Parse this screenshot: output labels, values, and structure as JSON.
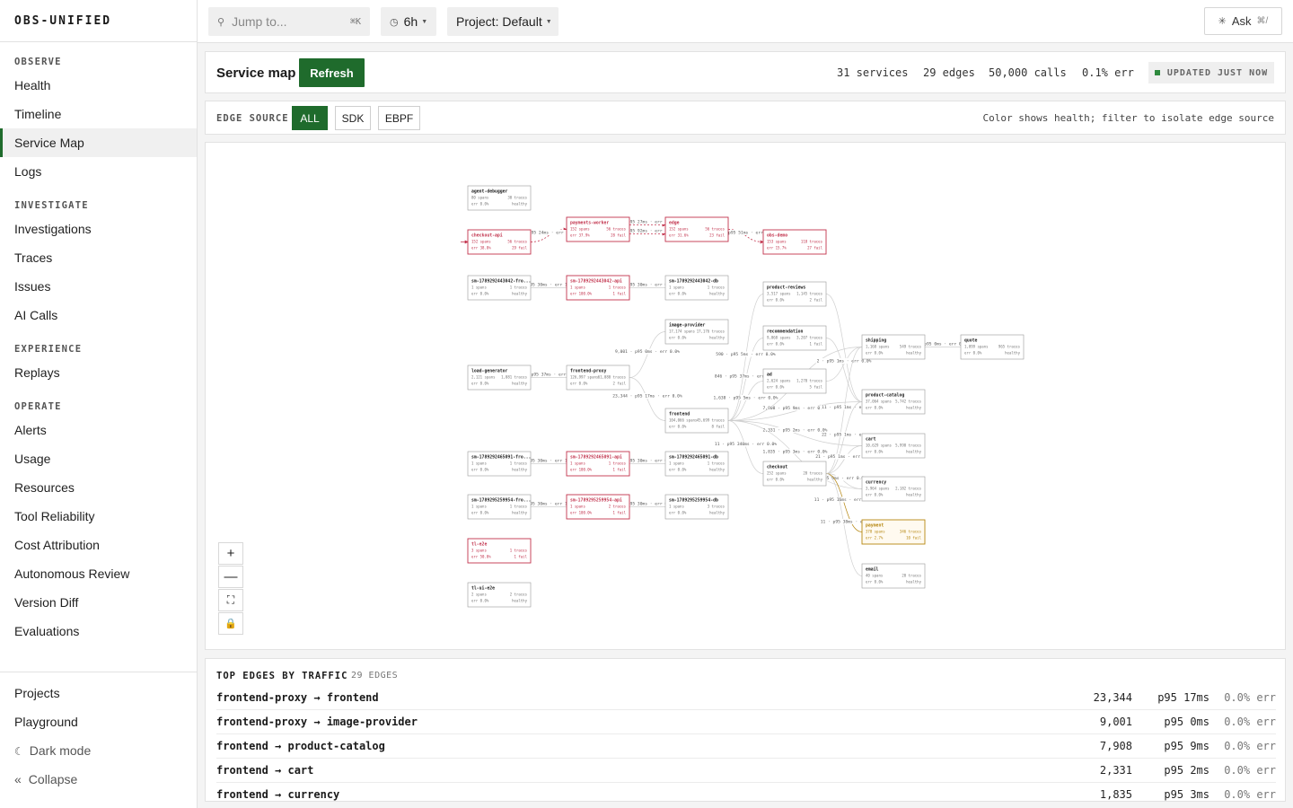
{
  "brand": "OBS-UNIFIED",
  "nav": {
    "sections": [
      {
        "title": "OBSERVE",
        "items": [
          "Health",
          "Timeline",
          "Service Map",
          "Logs"
        ]
      },
      {
        "title": "INVESTIGATE",
        "items": [
          "Investigations",
          "Traces",
          "Issues",
          "AI Calls"
        ]
      },
      {
        "title": "EXPERIENCE",
        "items": [
          "Replays"
        ]
      },
      {
        "title": "OPERATE",
        "items": [
          "Alerts",
          "Usage",
          "Resources",
          "Tool Reliability",
          "Cost Attribution",
          "Autonomous Review",
          "Version Diff",
          "Evaluations"
        ]
      }
    ],
    "active": "Service Map",
    "bottom": {
      "projects": "Projects",
      "playground": "Playground",
      "dark_mode": "Dark mode",
      "collapse": "Collapse"
    }
  },
  "topbar": {
    "jump_placeholder": "Jump to...",
    "jump_kbd": "⌘K",
    "range": "6h",
    "project": "Project: Default",
    "ask": "Ask",
    "ask_kbd": "⌘/"
  },
  "header": {
    "title": "Service map",
    "refresh": "Refresh",
    "stats": {
      "services": "31 services",
      "edges": "29 edges",
      "calls": "50,000 calls",
      "err": "0.1% err"
    },
    "updated": "UPDATED JUST NOW"
  },
  "filter": {
    "label": "EDGE SOURCE",
    "options": [
      "ALL",
      "SDK",
      "EBPF"
    ],
    "selected": "ALL",
    "hint": "Color shows health; filter to isolate edge source"
  },
  "colors": {
    "accent": "#1f6b2c",
    "error": "#c2334d",
    "warning": "#b5860f",
    "healthy": "#999999"
  },
  "map": {
    "nodes": [
      {
        "id": "agent-debugger",
        "name": "agent-debugger",
        "spans": "80 spans",
        "traces": "30 traces",
        "err": "err 0.0%",
        "status": "healthy",
        "health": "ok"
      },
      {
        "id": "checkout-api",
        "name": "checkout-api",
        "spans": "152 spans",
        "traces": "56 traces",
        "err": "err 38.8%",
        "status": "29 fail",
        "health": "error"
      },
      {
        "id": "payments-worker",
        "name": "payments-worker",
        "spans": "152 spans",
        "traces": "56 traces",
        "err": "err 37.9%",
        "status": "28 fail",
        "health": "error"
      },
      {
        "id": "edge",
        "name": "edge",
        "spans": "152 spans",
        "traces": "56 traces",
        "err": "err 31.6%",
        "status": "23 fail",
        "health": "error"
      },
      {
        "id": "obs-demo",
        "name": "obs-demo",
        "spans": "153 spans",
        "traces": "118 traces",
        "err": "err 15.7%",
        "status": "27 fail",
        "health": "error"
      },
      {
        "id": "sm3042-fro",
        "name": "sm-1789292443042-fro...",
        "spans": "1 spans",
        "traces": "1 traces",
        "err": "err 0.0%",
        "status": "healthy",
        "health": "ok"
      },
      {
        "id": "sm3042-api",
        "name": "sm-1789292443042-api",
        "spans": "1 spans",
        "traces": "1 traces",
        "err": "err 100.0%",
        "status": "1 fail",
        "health": "error"
      },
      {
        "id": "sm3042-db",
        "name": "sm-1789292443042-db",
        "spans": "1 spans",
        "traces": "1 traces",
        "err": "err 0.0%",
        "status": "healthy",
        "health": "ok"
      },
      {
        "id": "product-reviews",
        "name": "product-reviews",
        "spans": "3,517 spans",
        "traces": "1,145 traces",
        "err": "err 0.0%",
        "status": "2 fail",
        "health": "ok"
      },
      {
        "id": "image-provider",
        "name": "image-provider",
        "spans": "17,174 spans",
        "traces": "17,176 traces",
        "err": "err 0.0%",
        "status": "healthy",
        "health": "ok"
      },
      {
        "id": "recommendation",
        "name": "recommendation",
        "spans": "9,868 spans",
        "traces": "3,207 traces",
        "err": "err 0.0%",
        "status": "1 fail",
        "health": "ok"
      },
      {
        "id": "shipping",
        "name": "shipping",
        "spans": "1,168 spans",
        "traces": "549 traces",
        "err": "err 0.0%",
        "status": "healthy",
        "health": "ok"
      },
      {
        "id": "quote",
        "name": "quote",
        "spans": "1,099 spans",
        "traces": "965 traces",
        "err": "err 0.0%",
        "status": "healthy",
        "health": "ok"
      },
      {
        "id": "load-generator",
        "name": "load-generator",
        "spans": "2,121 spans",
        "traces": "1,081 traces",
        "err": "err 0.0%",
        "status": "healthy",
        "health": "ok"
      },
      {
        "id": "frontend-proxy",
        "name": "frontend-proxy",
        "spans": "126,997 spans",
        "traces": "61,080 traces",
        "err": "err 0.0%",
        "status": "2 fail",
        "health": "ok"
      },
      {
        "id": "ad",
        "name": "ad",
        "spans": "2,624 spans",
        "traces": "1,270 traces",
        "err": "err 0.0%",
        "status": "5 fail",
        "health": "ok"
      },
      {
        "id": "product-catalog",
        "name": "product-catalog",
        "spans": "37,064 spans",
        "traces": "5,742 traces",
        "err": "err 0.0%",
        "status": "healthy",
        "health": "ok"
      },
      {
        "id": "frontend",
        "name": "frontend",
        "spans": "104,066 spans",
        "traces": "45,699 traces",
        "err": "err 0.0%",
        "status": "8 fail",
        "health": "ok"
      },
      {
        "id": "cart",
        "name": "cart",
        "spans": "10,629 spans",
        "traces": "5,998 traces",
        "err": "err 0.0%",
        "status": "healthy",
        "health": "ok"
      },
      {
        "id": "checkout",
        "name": "checkout",
        "spans": "252 spans",
        "traces": "28 traces",
        "err": "err 0.0%",
        "status": "healthy",
        "health": "ok"
      },
      {
        "id": "sm5091-fro",
        "name": "sm-1789292465091-fro...",
        "spans": "1 spans",
        "traces": "1 traces",
        "err": "err 0.0%",
        "status": "healthy",
        "health": "ok"
      },
      {
        "id": "sm5091-api",
        "name": "sm-1789292465091-api",
        "spans": "1 spans",
        "traces": "1 traces",
        "err": "err 100.0%",
        "status": "1 fail",
        "health": "error"
      },
      {
        "id": "sm5091-db",
        "name": "sm-1789292465091-db",
        "spans": "1 spans",
        "traces": "1 traces",
        "err": "err 0.0%",
        "status": "healthy",
        "health": "ok"
      },
      {
        "id": "currency",
        "name": "currency",
        "spans": "3,964 spans",
        "traces": "2,182 traces",
        "err": "err 0.0%",
        "status": "healthy",
        "health": "ok"
      },
      {
        "id": "sm9954-fro",
        "name": "sm-1789295259954-fro...",
        "spans": "1 spans",
        "traces": "1 traces",
        "err": "err 0.0%",
        "status": "healthy",
        "health": "ok"
      },
      {
        "id": "sm9954-api",
        "name": "sm-1789295259954-api",
        "spans": "1 spans",
        "traces": "2 traces",
        "err": "err 100.0%",
        "status": "1 fail",
        "health": "error"
      },
      {
        "id": "sm9954-db",
        "name": "sm-1789295259954-db",
        "spans": "1 spans",
        "traces": "3 traces",
        "err": "err 0.0%",
        "status": "healthy",
        "health": "ok"
      },
      {
        "id": "payment",
        "name": "payment",
        "spans": "378 spans",
        "traces": "346 traces",
        "err": "err 2.7%",
        "status": "10 fail",
        "health": "warning"
      },
      {
        "id": "tl-e2e",
        "name": "tl-e2e",
        "spans": "3 spans",
        "traces": "1 traces",
        "err": "err 50.0%",
        "status": "1 fail",
        "health": "error"
      },
      {
        "id": "email",
        "name": "email",
        "spans": "40 spans",
        "traces": "20 traces",
        "err": "err 0.0%",
        "status": "healthy",
        "health": "ok"
      },
      {
        "id": "tl-ui-e2e",
        "name": "tl-ui-e2e",
        "spans": "2 spans",
        "traces": "2 traces",
        "err": "err 0.0%",
        "status": "healthy",
        "health": "ok"
      }
    ],
    "edges": [
      {
        "from": "checkout-api",
        "to": "payments-worker",
        "label": "p95 24ms · err 1",
        "health": "error"
      },
      {
        "from": "payments-worker",
        "to": "edge",
        "label": "p95 27ms · err 1",
        "health": "error"
      },
      {
        "from": "payments-worker",
        "to": "edge",
        "label": "p95 92ms · err 1",
        "health": "error"
      },
      {
        "from": "edge",
        "to": "obs-demo",
        "label": "p95 51ms · err",
        "health": "error"
      },
      {
        "from": "sm3042-fro",
        "to": "sm3042-api",
        "label": "p95 30ms · err 10",
        "health": "ok"
      },
      {
        "from": "sm3042-api",
        "to": "sm3042-db",
        "label": "p95 30ms · err 0",
        "health": "ok"
      },
      {
        "from": "load-generator",
        "to": "frontend-proxy",
        "label": "p95 37ms · err",
        "health": "ok"
      },
      {
        "from": "frontend-proxy",
        "to": "image-provider",
        "label": "9,001 · p95 0ms · err 0.0%",
        "health": "ok"
      },
      {
        "from": "frontend-proxy",
        "to": "frontend",
        "label": "23,344 · p95 17ms · err 0.0%",
        "health": "ok"
      },
      {
        "from": "frontend",
        "to": "recommendation",
        "label": "846 · p95 37ms · err 0.0%",
        "health": "ok"
      },
      {
        "from": "frontend",
        "to": "ad",
        "label": "1,638 · p95 5ms · err 0.0%",
        "health": "ok"
      },
      {
        "from": "frontend",
        "to": "product-reviews",
        "label": "590 · p95 5ms · err 0.0%",
        "health": "ok"
      },
      {
        "from": "frontend",
        "to": "product-catalog",
        "label": "7,908 · p95 9ms · err 0.0%",
        "health": "ok"
      },
      {
        "from": "frontend",
        "to": "cart",
        "label": "2,331 · p95 2ms · err 0.0%",
        "health": "ok"
      },
      {
        "from": "frontend",
        "to": "currency",
        "label": "1,835 · p95 3ms · err 0.0%",
        "health": "ok"
      },
      {
        "from": "frontend",
        "to": "checkout",
        "label": "11 · p95 340ms · err 0.0%",
        "health": "ok"
      },
      {
        "from": "frontend",
        "to": "shipping",
        "label": "",
        "health": "ok"
      },
      {
        "from": "recommendation",
        "to": "product-catalog",
        "label": "",
        "health": "ok"
      },
      {
        "from": "product-reviews",
        "to": "product-catalog",
        "label": "",
        "health": "ok"
      },
      {
        "from": "ad",
        "to": "shipping",
        "label": "2 · p95 1ms · err 0.0%",
        "health": "ok"
      },
      {
        "from": "shipping",
        "to": "quote",
        "label": "p95 0ms · err 0",
        "health": "ok"
      },
      {
        "from": "checkout",
        "to": "shipping",
        "label": "11 · p95 1ms · err",
        "health": "ok"
      },
      {
        "from": "checkout",
        "to": "product-catalog",
        "label": "22 · p95 1ms · err",
        "health": "ok"
      },
      {
        "from": "checkout",
        "to": "cart",
        "label": "21 · p95 1ms · err 0.0%",
        "health": "ok"
      },
      {
        "from": "checkout",
        "to": "currency",
        "label": "p95 0ms · err 0.0%",
        "health": "ok"
      },
      {
        "from": "checkout",
        "to": "payment",
        "label": "11 · p95 16ms · err 0.0%",
        "health": "warning"
      },
      {
        "from": "checkout",
        "to": "email",
        "label": "11 · p95 38ms · err",
        "health": "ok"
      },
      {
        "from": "sm5091-fro",
        "to": "sm5091-api",
        "label": "p95 30ms · err 10",
        "health": "ok"
      },
      {
        "from": "sm5091-api",
        "to": "sm5091-db",
        "label": "p95 30ms · err 0",
        "health": "ok"
      },
      {
        "from": "sm9954-fro",
        "to": "sm9954-api",
        "label": "p95 30ms · err 10",
        "health": "ok"
      },
      {
        "from": "sm9954-api",
        "to": "sm9954-db",
        "label": "p95 30ms · err 0",
        "health": "ok"
      }
    ],
    "zoom_controls": [
      "zoom-in",
      "zoom-out",
      "fit-view",
      "lock"
    ]
  },
  "top_edges": {
    "title": "TOP EDGES BY TRAFFIC",
    "count": "29 EDGES",
    "rows": [
      {
        "name": "frontend-proxy → frontend",
        "calls": "23,344",
        "p95": "p95 17ms",
        "err": "0.0% err"
      },
      {
        "name": "frontend-proxy → image-provider",
        "calls": "9,001",
        "p95": "p95 0ms",
        "err": "0.0% err"
      },
      {
        "name": "frontend → product-catalog",
        "calls": "7,908",
        "p95": "p95 9ms",
        "err": "0.0% err"
      },
      {
        "name": "frontend → cart",
        "calls": "2,331",
        "p95": "p95 2ms",
        "err": "0.0% err"
      },
      {
        "name": "frontend → currency",
        "calls": "1,835",
        "p95": "p95 3ms",
        "err": "0.0% err"
      }
    ]
  }
}
